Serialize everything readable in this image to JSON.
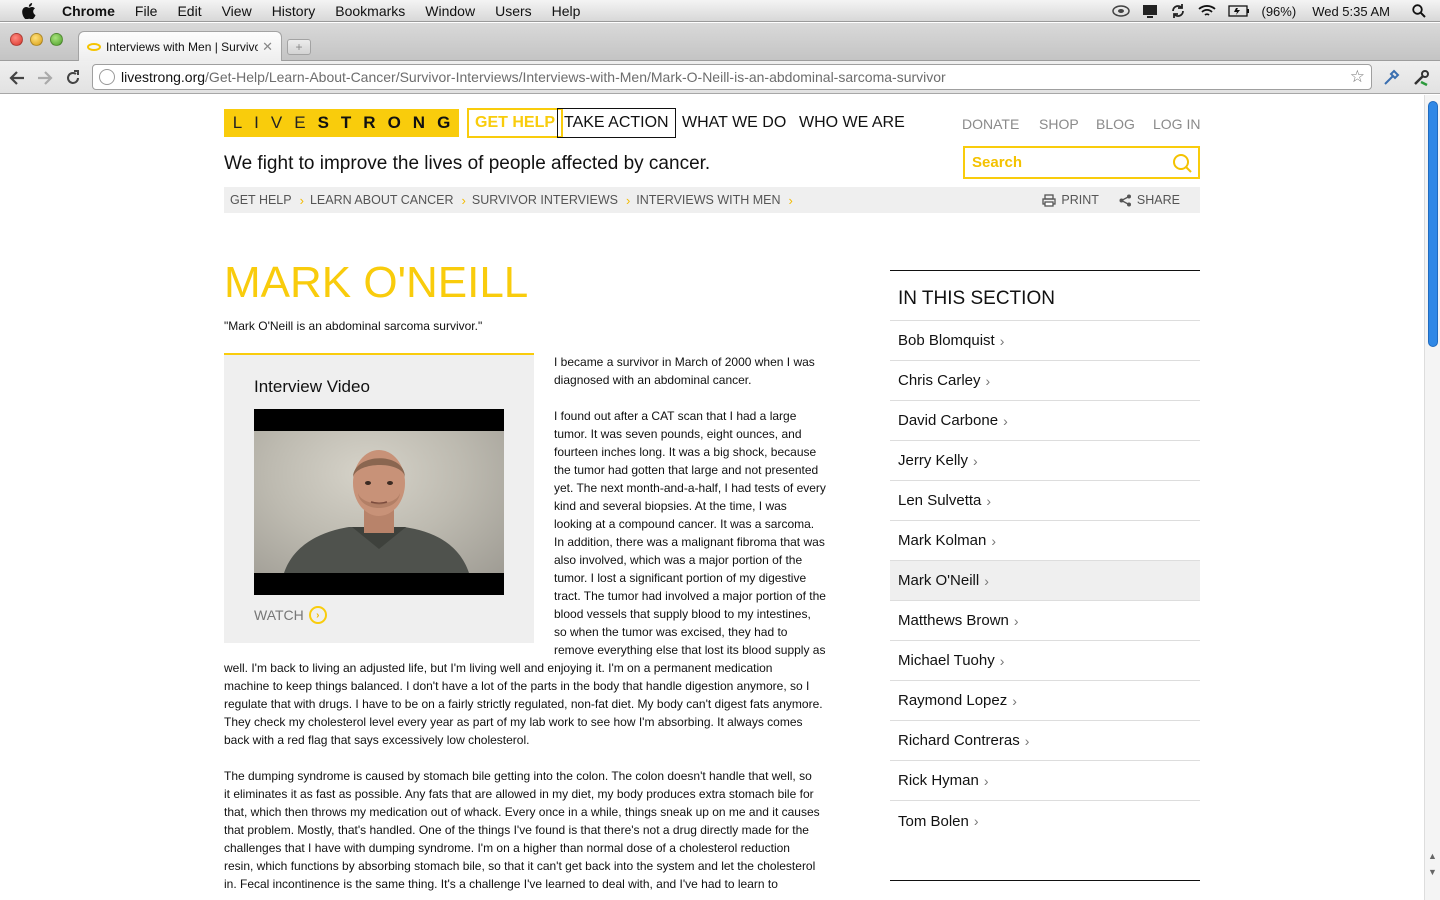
{
  "menubar": {
    "app": "Chrome",
    "items": [
      "File",
      "Edit",
      "View",
      "History",
      "Bookmarks",
      "Window",
      "Users",
      "Help"
    ],
    "battery": "(96%)",
    "clock": "Wed 5:35 AM"
  },
  "browser": {
    "tab_title": "Interviews with Men | Survivor Interviews",
    "url_host": "livestrong.org",
    "url_path": "/Get-Help/Learn-About-Cancer/Survivor-Interviews/Interviews-with-Men/Mark-O-Neill-is-an-abdominal-sarcoma-survivor"
  },
  "site": {
    "logo_part1": "LIVE",
    "logo_part2": "STRONG",
    "nav": [
      "GET HELP",
      "TAKE ACTION",
      "WHAT WE DO",
      "WHO WE ARE"
    ],
    "util": [
      "DONATE",
      "SHOP",
      "BLOG",
      "LOG IN"
    ],
    "tagline": "We fight to improve the lives of people affected by cancer.",
    "search_placeholder": "Search",
    "accent": "#f9cc0c"
  },
  "breadcrumb": {
    "items": [
      "GET HELP",
      "LEARN ABOUT CANCER",
      "SURVIVOR INTERVIEWS",
      "INTERVIEWS WITH MEN"
    ],
    "print": "PRINT",
    "share": "SHARE"
  },
  "article": {
    "title": "MARK O'NEILL",
    "subtitle": "\"Mark O'Neill is an abdominal sarcoma survivor.\"",
    "video_title": "Interview Video",
    "watch": "WATCH",
    "side_paragraphs": [
      [
        "I became a survivor in March of 2000 when I was",
        "diagnosed with an abdominal cancer."
      ],
      [
        "I found out after a CAT scan that I had a large",
        "tumor. It was seven pounds, eight ounces, and",
        "fourteen inches long. It was a big shock, because",
        "the tumor had gotten that large and not presented",
        "yet. The next month-and-a-half, I had tests of every",
        "kind and several biopsies. At the time, I was",
        "looking at a compound cancer. It was a sarcoma.",
        "In addition, there was a malignant fibroma that was",
        "also involved, which was a major portion of the",
        "tumor. I lost a significant portion of my digestive",
        "tract. The tumor had involved a major portion of the",
        "blood vessels that supply blood to my intestines,",
        "so when the tumor was excised, they had to",
        "remove everything else that lost its blood supply as"
      ]
    ],
    "full_lines_1": [
      "well. I'm back to living an adjusted life, but I'm living well and enjoying it. I'm on a permanent medication",
      "machine to keep things balanced. I don't have a lot of the parts in the body that handle digestion anymore, so I",
      "regulate that with drugs. I have to be on a fairly strictly regulated, non-fat diet. My body can't digest fats anymore.",
      "They check my cholesterol level every year as part of my lab work to see how I'm absorbing. It always comes",
      "back with a red flag that says excessively low cholesterol."
    ],
    "full_lines_2": [
      "The dumping syndrome is caused by stomach bile getting into the colon. The colon doesn't handle that well, so",
      "it eliminates it as fast as possible. Any fats that are allowed in my diet, my body produces extra stomach bile for",
      "that, which then throws my medication out of whack. Every once in a while, things sneak up on me and it causes",
      "that problem. Mostly, that's handled. One of the things I've found is that there's not a drug directly made for the",
      "challenges that I have with dumping syndrome. I'm on a higher than normal dose of a cholesterol reduction",
      "resin, which functions by absorbing stomach bile, so that it can't get back into the system and let the cholesterol",
      "in. Fecal incontinence is the same thing. It's a challenge I've learned to deal with, and I've had to learn to"
    ]
  },
  "sidebar": {
    "heading": "IN THIS SECTION",
    "items": [
      "Bob Blomquist",
      "Chris Carley",
      "David Carbone",
      "Jerry Kelly",
      "Len Sulvetta",
      "Mark Kolman",
      "Mark O'Neill",
      "Matthews Brown",
      "Michael Tuohy",
      "Raymond Lopez",
      "Richard Contreras",
      "Rick Hyman",
      "Tom Bolen"
    ],
    "active": "Mark O'Neill"
  }
}
